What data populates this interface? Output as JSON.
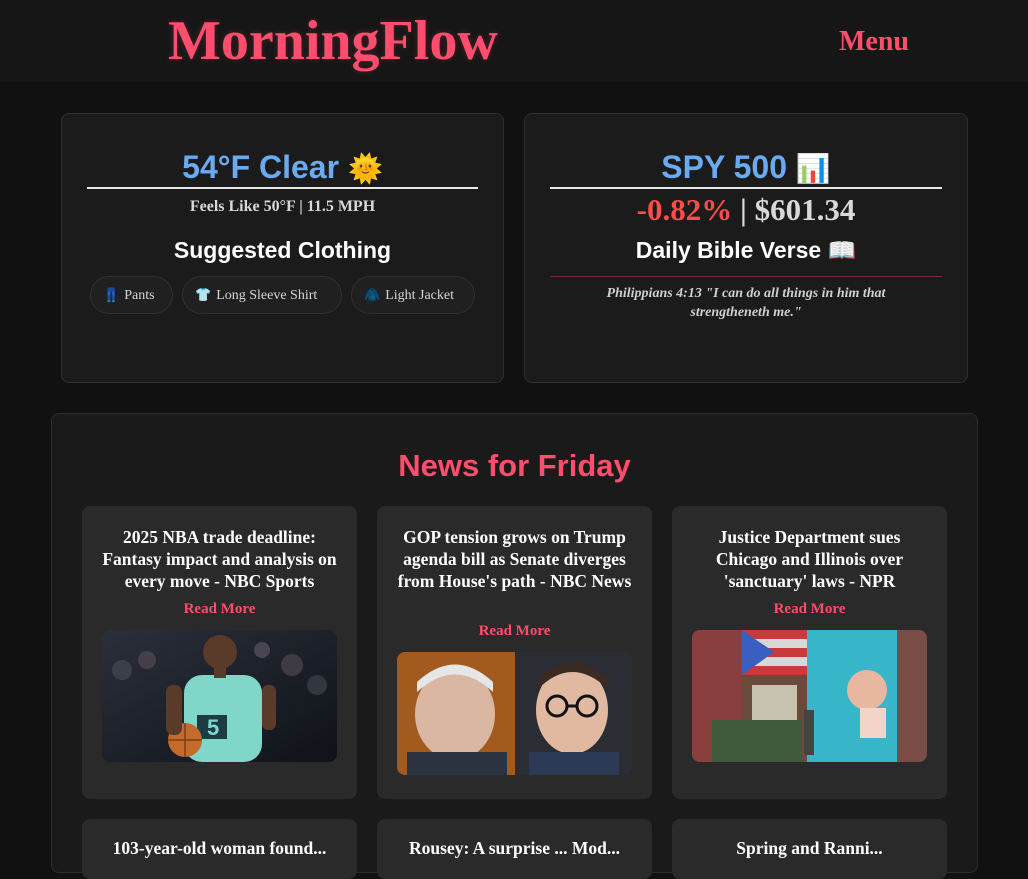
{
  "header": {
    "logo": "MorningFlow",
    "menu_label": "Menu"
  },
  "weather": {
    "headline": "54°F Clear",
    "icon": "sun-emoji",
    "icon_glyph": "🌞",
    "details": "Feels Like 50°F | 11.5 MPH",
    "clothing_heading": "Suggested Clothing",
    "clothing": [
      {
        "icon": "jeans-icon",
        "glyph": "👖",
        "label": "Pants"
      },
      {
        "icon": "shirt-icon",
        "glyph": "👕",
        "label": "Long Sleeve Shirt"
      },
      {
        "icon": "jacket-icon",
        "glyph": "🧥",
        "label": "Light Jacket"
      }
    ]
  },
  "market": {
    "headline": "SPY 500",
    "icon": "bar-chart-emoji",
    "icon_glyph": "📊",
    "change": "-0.82%",
    "separator": "|",
    "price": "$601.34",
    "verse_heading": "Daily Bible Verse",
    "verse_icon_glyph": "📖",
    "verse_text": "Philippians 4:13 \"I can do all things in him that strengtheneth me.\""
  },
  "news": {
    "heading": "News for Friday",
    "read_more_label": "Read More",
    "articles": [
      {
        "title": "2025 NBA trade deadline: Fantasy impact and analysis on every move - NBC Sports"
      },
      {
        "title": "GOP tension grows on Trump agenda bill as Senate diverges from House's path - NBC News"
      },
      {
        "title": "Justice Department sues Chicago and Illinois over 'sanctuary' laws - NPR"
      }
    ],
    "row2": [
      {
        "title": "103-year-old woman found..."
      },
      {
        "title": "Rousey: A surprise ... Mod..."
      },
      {
        "title": "Spring and Ranni..."
      }
    ]
  },
  "colors": {
    "accent": "#ff4d6d",
    "blue": "#6aaaf0",
    "negative": "#ff4b4b",
    "background": "#111111",
    "card": "#1b1b1b"
  }
}
